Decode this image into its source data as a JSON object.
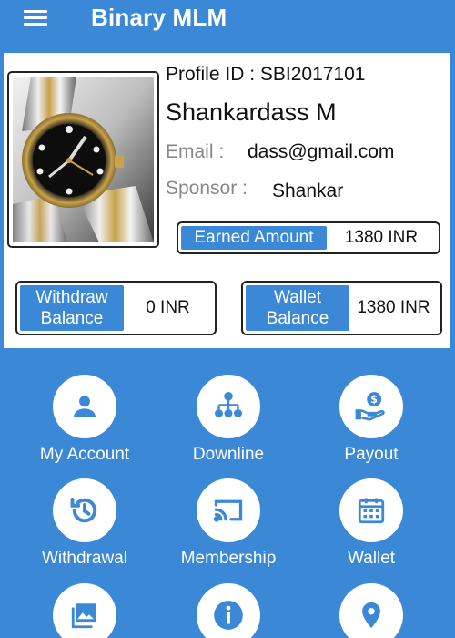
{
  "app": {
    "title": "Binary MLM"
  },
  "profile": {
    "id_text": "Profile ID : SBI2017101",
    "name": "Shankardass M",
    "email_label": "Email :",
    "email_value": "dass@gmail.com",
    "sponsor_label": "Sponsor :",
    "sponsor_value": "Shankar",
    "earned_label": "Earned Amount",
    "earned_value": "1380 INR",
    "withdraw_label_line1": "Withdraw",
    "withdraw_label_line2": "Balance",
    "withdraw_value": "0 INR",
    "wallet_label_line1": "Wallet",
    "wallet_label_line2": "Balance",
    "wallet_value": "1380 INR"
  },
  "menu": [
    {
      "label": "My Account",
      "icon": "person-icon"
    },
    {
      "label": "Downline",
      "icon": "hierarchy-icon"
    },
    {
      "label": "Payout",
      "icon": "money-hand-icon"
    },
    {
      "label": "Withdrawal",
      "icon": "history-icon"
    },
    {
      "label": "Membership",
      "icon": "cast-icon"
    },
    {
      "label": "Wallet",
      "icon": "calendar-icon"
    },
    {
      "label": "",
      "icon": "image-icon"
    },
    {
      "label": "",
      "icon": "info-icon"
    },
    {
      "label": "",
      "icon": "location-pin-icon"
    }
  ],
  "colors": {
    "primary": "#3b89d6",
    "card": "#ffffff",
    "text": "#111111",
    "muted": "#888888"
  }
}
